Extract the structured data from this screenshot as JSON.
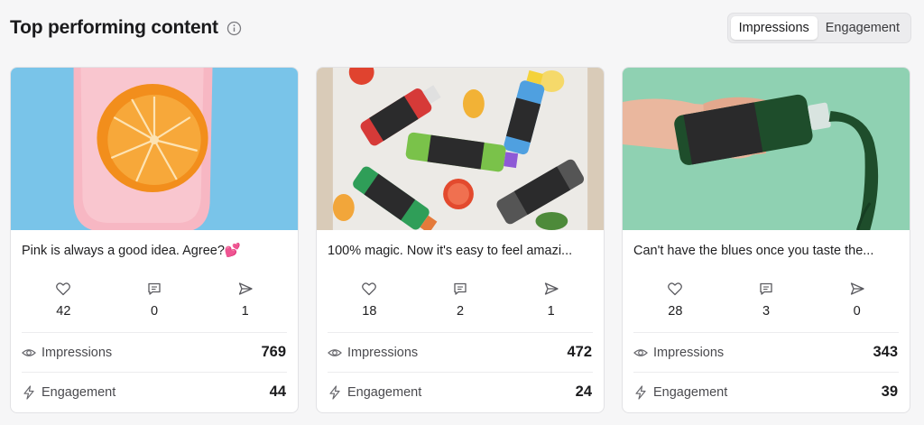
{
  "header": {
    "title": "Top performing content",
    "info_icon": "info-circle-icon",
    "toggle": [
      "Impressions",
      "Engagement"
    ],
    "active_toggle": "Impressions"
  },
  "labels": {
    "impressions": "Impressions",
    "engagement": "Engagement"
  },
  "cards": [
    {
      "image": "orange slice in pink drink on blue background",
      "caption": "Pink is always a good idea. Agree?💕",
      "likes": "42",
      "comments": "0",
      "shares": "1",
      "impressions": "769",
      "engagement": "44"
    },
    {
      "image": "fresh pressed juice bottles on tray with citrus",
      "caption": "100% magic. Now it's easy to feel amazi...",
      "likes": "18",
      "comments": "2",
      "shares": "1",
      "impressions": "472",
      "engagement": "24"
    },
    {
      "image": "hand pouring green juice bottle on mint background",
      "caption": "Can't have the blues once you taste the...",
      "likes": "28",
      "comments": "3",
      "shares": "0",
      "impressions": "343",
      "engagement": "39"
    }
  ],
  "colors": {
    "card1_bg": "#78c3e8",
    "card2_bg": "#e4dfd8",
    "card3_bg": "#8fd1b2",
    "accent": "#1b1b1d"
  }
}
